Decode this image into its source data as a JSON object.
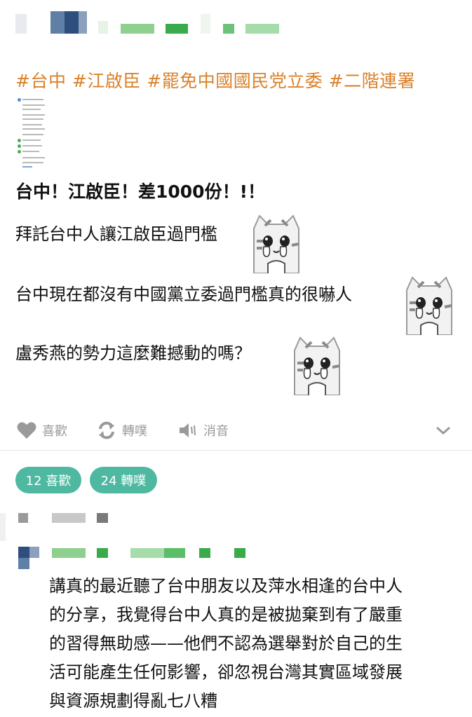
{
  "post": {
    "hashtags": "#台中 #江啟臣 #罷免中國國民党立委 #二階連署",
    "headline": "台中！江啟臣！差1000份！!！",
    "lines": [
      "拜託台中人讓江啟臣過門檻",
      "台中現在都沒有中國黨立委過門檻真的很嚇人",
      "盧秀燕的勢力這麼難撼動的嗎？"
    ]
  },
  "actions": {
    "like": "喜歡",
    "repost": "轉噗",
    "mute": "消音"
  },
  "stats": {
    "likes": "12 喜歡",
    "reposts": "24 轉噗"
  },
  "comment": {
    "lines": [
      "講真的最近聽了台中朋友以及萍水相逢的台中人",
      "的分享，我覺得台中人真的是被拋棄到有了嚴重",
      "的習得無助感——他們不認為選舉對於自己的生",
      "活可能產生任何影響，卻忽視台灣其實區域發展",
      "與資源規劃得亂七八糟"
    ]
  },
  "colors": {
    "hashtag": "#d9822b",
    "pill": "#4fb8a0",
    "icon_gray": "#9a9a9a"
  }
}
